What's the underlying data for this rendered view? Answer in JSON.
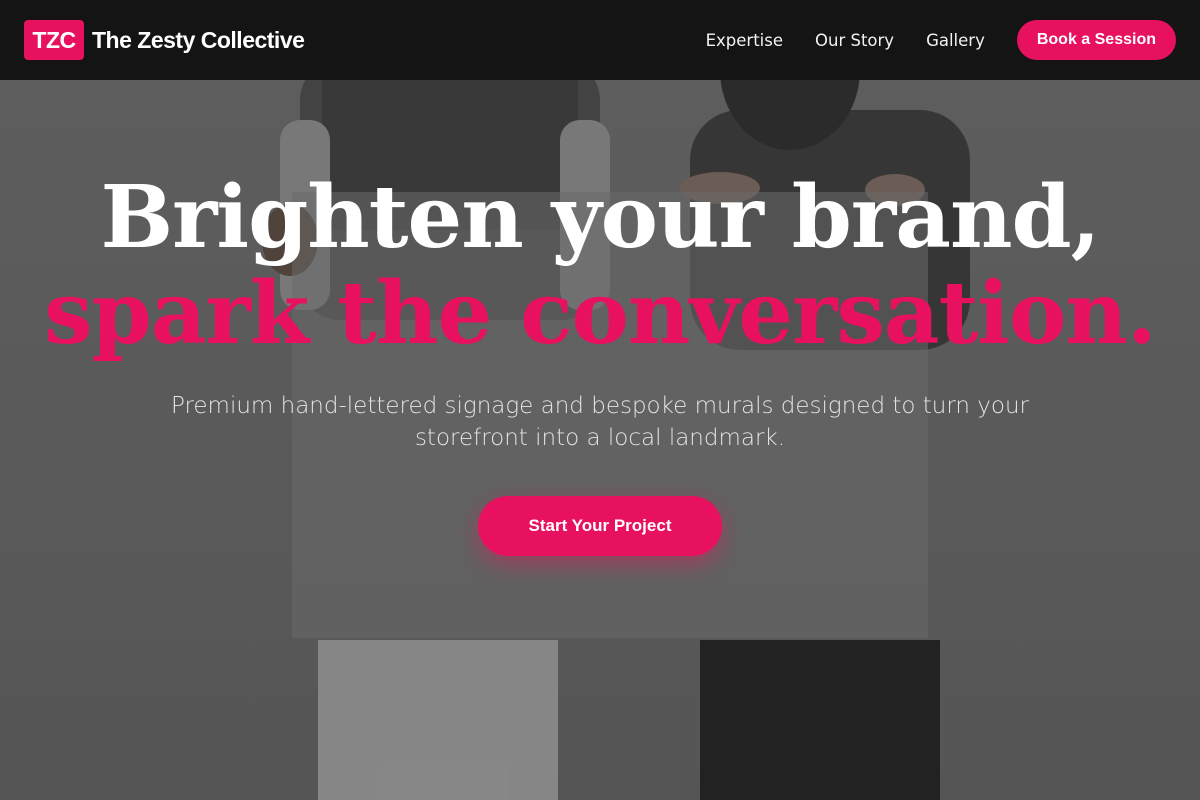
{
  "brand": {
    "logo_text": "TZC",
    "name": "The Zesty Collective"
  },
  "nav": {
    "links": [
      {
        "label": "Expertise"
      },
      {
        "label": "Our Story"
      },
      {
        "label": "Gallery"
      }
    ],
    "cta_label": "Book a Session"
  },
  "hero": {
    "headline_part1": "Brighten your brand, ",
    "headline_part2": "spark the conversation.",
    "subheadline": "Premium hand-lettered signage and bespoke murals designed to turn your storefront into a local landmark.",
    "cta_label": "Start Your Project"
  },
  "colors": {
    "accent": "#e8115f",
    "navbar_bg": "#141414",
    "text_light": "#ffffff"
  },
  "icons": {
    "logo": "tzc-logo-badge"
  }
}
